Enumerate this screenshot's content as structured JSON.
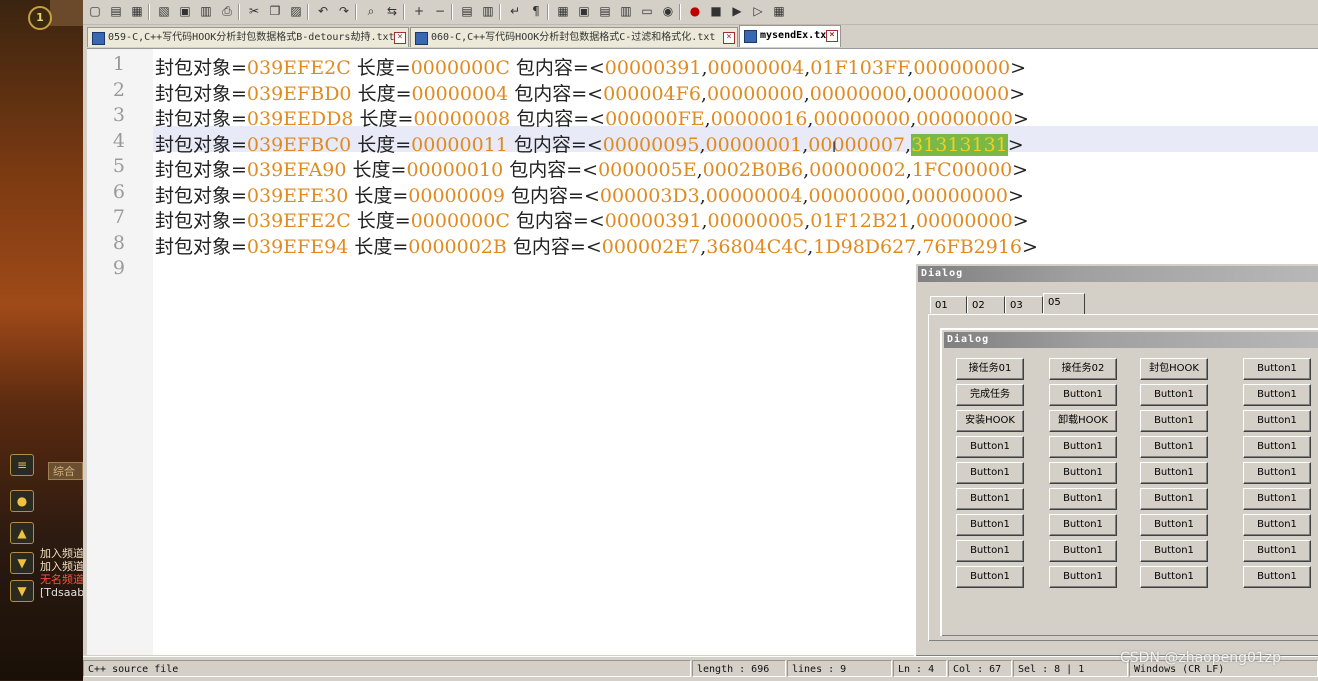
{
  "game": {
    "level_badge": "1",
    "tab_chip": "综合",
    "chat_lines": [
      "加入频道",
      "加入频道",
      "无名频道",
      "[Tdsaab"
    ]
  },
  "toolbar": {
    "icons": [
      "new-file-icon",
      "open-icon",
      "save-icon",
      "save-all-icon",
      "close-icon",
      "close-all-icon",
      "print-icon",
      "cut-icon",
      "copy-icon",
      "paste-icon",
      "undo-icon",
      "redo-icon",
      "find-icon",
      "replace-icon",
      "zoom-in-icon",
      "zoom-out-icon",
      "sync-v-icon",
      "sync-h-icon",
      "wrap-icon",
      "show-all-chars-icon",
      "indent-guide-icon",
      "user-lang-icon",
      "doc-map-icon",
      "function-list-icon",
      "folder-icon",
      "monitor-icon",
      "record-macro-icon",
      "stop-macro-icon",
      "play-macro-icon",
      "run-macro-icon",
      "save-macro-icon"
    ]
  },
  "file_tabs": [
    {
      "label": "059-C,C++写代码HOOK分析封包数据格式B-detours劫持.txt",
      "active": false
    },
    {
      "label": "060-C,C++写代码HOOK分析封包数据格式C-过滤和格式化.txt",
      "active": false
    },
    {
      "label": "mysendEx.txt",
      "active": true
    }
  ],
  "editor": {
    "line_numbers": [
      "1",
      "2",
      "3",
      "4",
      "5",
      "6",
      "7",
      "8",
      "9"
    ],
    "current_line": "4",
    "lines": [
      {
        "obj_label": "封包对象=",
        "obj": "039EFE2C",
        "len_label": " 长度=",
        "len": "0000000C",
        "content_label": " 包内容=<",
        "v1": "00000391",
        "v2": "00000004",
        "v3": "01F103FF",
        "v4": "00000000",
        "end": ">"
      },
      {
        "obj_label": "封包对象=",
        "obj": "039EFBD0",
        "len_label": " 长度=",
        "len": "00000004",
        "content_label": " 包内容=<",
        "v1": "000004F6",
        "v2": "00000000",
        "v3": "00000000",
        "v4": "00000000",
        "end": ">"
      },
      {
        "obj_label": "封包对象=",
        "obj": "039EEDD8",
        "len_label": " 长度=",
        "len": "00000008",
        "content_label": " 包内容=<",
        "v1": "000000FE",
        "v2": "00000016",
        "v3": "00000000",
        "v4": "00000000",
        "end": ">"
      },
      {
        "obj_label": "封包对象=",
        "obj": "039EFBC0",
        "len_label": " 长度=",
        "len": "00000011",
        "content_label": " 包内容=<",
        "v1": "00000095",
        "v2": "00000001",
        "v3": "00000007",
        "v4": "31313131",
        "end": ">"
      },
      {
        "obj_label": "封包对象=",
        "obj": "039EFA90",
        "len_label": " 长度=",
        "len": "00000010",
        "content_label": " 包内容=<",
        "v1": "0000005E",
        "v2": "0002B0B6",
        "v3": "00000002",
        "v4": "1FC00000",
        "end": ">"
      },
      {
        "obj_label": "封包对象=",
        "obj": "039EFE30",
        "len_label": " 长度=",
        "len": "00000009",
        "content_label": " 包内容=<",
        "v1": "000003D3",
        "v2": "00000004",
        "v3": "00000000",
        "v4": "00000000",
        "end": ">"
      },
      {
        "obj_label": "封包对象=",
        "obj": "039EFE2C",
        "len_label": " 长度=",
        "len": "0000000C",
        "content_label": " 包内容=<",
        "v1": "00000391",
        "v2": "00000005",
        "v3": "01F12B21",
        "v4": "00000000",
        "end": ">"
      },
      {
        "obj_label": "封包对象=",
        "obj": "039EFE94",
        "len_label": " 长度=",
        "len": "0000002B",
        "content_label": " 包内容=<",
        "v1": "000002E7",
        "v2": "36804C4C",
        "v3": "1D98D627",
        "v4": "76FB2916",
        "end": ">"
      }
    ]
  },
  "statusbar": {
    "file_type": "C++ source file",
    "length": "length : 696",
    "lines": "lines : 9",
    "ln": "Ln : 4",
    "col": "Col : 67",
    "sel": "Sel : 8 | 1",
    "eol": "Windows (CR LF)"
  },
  "dialog": {
    "title": "Dialog",
    "tabs": [
      "01",
      "02",
      "03",
      "05"
    ],
    "active_tab": "05",
    "sub_title": "Dialog",
    "buttons": [
      [
        "接任务01",
        "接任务02",
        "封包HOOK",
        "Button1"
      ],
      [
        "完成任务",
        "Button1",
        "Button1",
        "Button1"
      ],
      [
        "安装HOOK",
        "卸载HOOK",
        "Button1",
        "Button1"
      ],
      [
        "Button1",
        "Button1",
        "Button1",
        "Button1"
      ],
      [
        "Button1",
        "Button1",
        "Button1",
        "Button1"
      ],
      [
        "Button1",
        "Button1",
        "Button1",
        "Button1"
      ],
      [
        "Button1",
        "Button1",
        "Button1",
        "Button1"
      ],
      [
        "Button1",
        "Button1",
        "Button1",
        "Button1"
      ],
      [
        "Button1",
        "Button1",
        "Button1",
        "Button1"
      ]
    ]
  },
  "watermark": "CSDN @zhaopeng01zp"
}
